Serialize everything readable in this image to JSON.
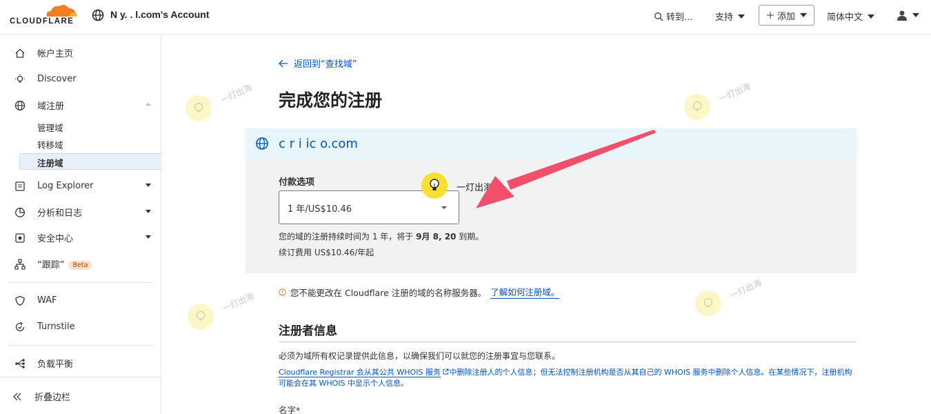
{
  "topbar": {
    "logo_text": "CLOUDFLARE",
    "account_name": "N     y.   .   l.com's Account",
    "search_label": "转到...",
    "support_label": "支持",
    "add_label": "添加",
    "language_label": "简体中文"
  },
  "sidebar": {
    "items": [
      {
        "label": "帐户主页",
        "icon": "home-icon"
      },
      {
        "label": "Discover",
        "icon": "lightbulb-icon"
      },
      {
        "label": "域注册",
        "icon": "globe-icon"
      },
      {
        "label": "Log Explorer",
        "icon": "log-icon"
      },
      {
        "label": "分析和日志",
        "icon": "chart-icon"
      },
      {
        "label": "安全中心",
        "icon": "security-center-icon"
      },
      {
        "label": "“跟踪”",
        "icon": "trace-icon"
      },
      {
        "label": "WAF",
        "icon": "shield-icon"
      },
      {
        "label": "Turnstile",
        "icon": "turnstile-icon"
      },
      {
        "label": "负载平衡",
        "icon": "load-balancing-icon"
      }
    ],
    "sub_items": [
      "管理域",
      "转移域",
      "注册域"
    ],
    "beta_badge": "Beta",
    "collapse_label": "折叠边栏"
  },
  "main": {
    "back_link": "返回到“查找域”",
    "title": "完成您的注册",
    "domain": "c   r  i  ic   o.com",
    "payment": {
      "label": "付款选项",
      "selected": "1 年/US$10.46",
      "duration_text_prefix": "您的域的注册持续时间为 1 年，将于 ",
      "expiry_date": "9月 8, 20",
      "duration_text_suffix": " 到期。",
      "renewal_text": "续订费用 US$10.46/年起"
    },
    "notice_text": "您不能更改在 Cloudflare 注册的域的名称服务器。",
    "notice_link": "了解如何注册域。",
    "registrant": {
      "title": "注册者信息",
      "required_text": "必须为域所有权记录提供此信息，以确保我们可以就您的注册事宜与您联系。",
      "whois_link": "Cloudflare Registrar 会从其公共 WHOIS 服务",
      "whois_text": "中删除注册人的个人信息；但无法控制注册机构是否从其自己的 WHOIS 服务中删除个人信息。在某些情况下，注册机构可能会在其 WHOIS 中显示个人信息。",
      "name_label": "名字*"
    }
  },
  "watermark": {
    "text": "一灯出海"
  },
  "colors": {
    "brand_orange": "#f38020",
    "link_blue": "#0051c3",
    "arrow_red": "#f0506a",
    "badge_yellow": "#f7e02e"
  }
}
